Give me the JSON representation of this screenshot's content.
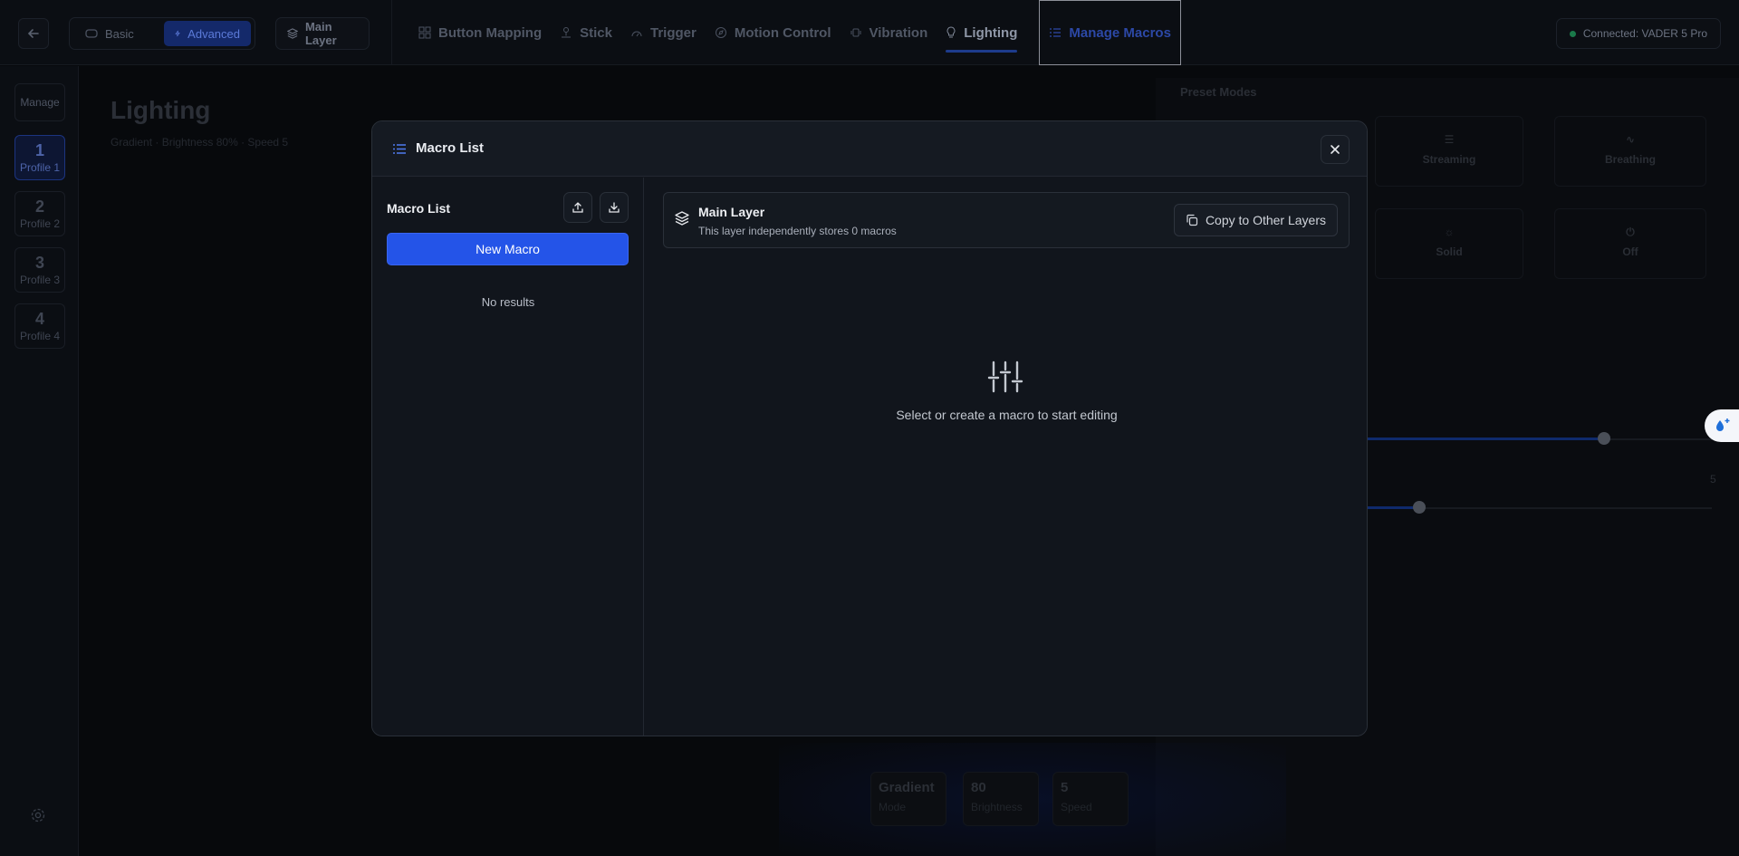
{
  "topbar": {
    "modes": {
      "basic": "Basic",
      "advanced": "Advanced"
    },
    "layer": "Main Layer",
    "nav": [
      {
        "label": "Button Mapping",
        "icon": "grid-icon"
      },
      {
        "label": "Stick",
        "icon": "joystick-icon"
      },
      {
        "label": "Trigger",
        "icon": "gauge-icon"
      },
      {
        "label": "Motion Control",
        "icon": "compass-icon"
      },
      {
        "label": "Vibration",
        "icon": "vibration-icon"
      },
      {
        "label": "Lighting",
        "icon": "lightbulb-icon"
      },
      {
        "label": "Manage Macros",
        "icon": "list-icon"
      }
    ],
    "active_tab": "Lighting",
    "connection": "Connected: VADER 5 Pro"
  },
  "sidebar": {
    "manage": "Manage",
    "profiles": [
      {
        "num": "1",
        "label": "Profile 1"
      },
      {
        "num": "2",
        "label": "Profile 2"
      },
      {
        "num": "3",
        "label": "Profile 3"
      },
      {
        "num": "4",
        "label": "Profile 4"
      }
    ]
  },
  "background": {
    "title": "Lighting",
    "subtitle": "Gradient · Brightness 80% · Speed 5",
    "preset_title": "Preset Modes",
    "presets": [
      "Streaming",
      "Breathing",
      "Solid",
      "Off"
    ],
    "speed_value": "5",
    "stats": [
      {
        "value": "Gradient",
        "key": "Mode"
      },
      {
        "value": "80",
        "key": "Brightness"
      },
      {
        "value": "5",
        "key": "Speed"
      }
    ]
  },
  "modal": {
    "title": "Macro List",
    "list_title": "Macro List",
    "new_macro": "New Macro",
    "no_results": "No results",
    "layer_title": "Main Layer",
    "layer_sub": "This layer independently stores 0 macros",
    "copy_button": "Copy to Other Layers",
    "empty_text": "Select or create a macro to start editing"
  },
  "colors": {
    "accent": "#2454e8",
    "modal_bg": "#11151c",
    "page_bg": "#07090c"
  }
}
